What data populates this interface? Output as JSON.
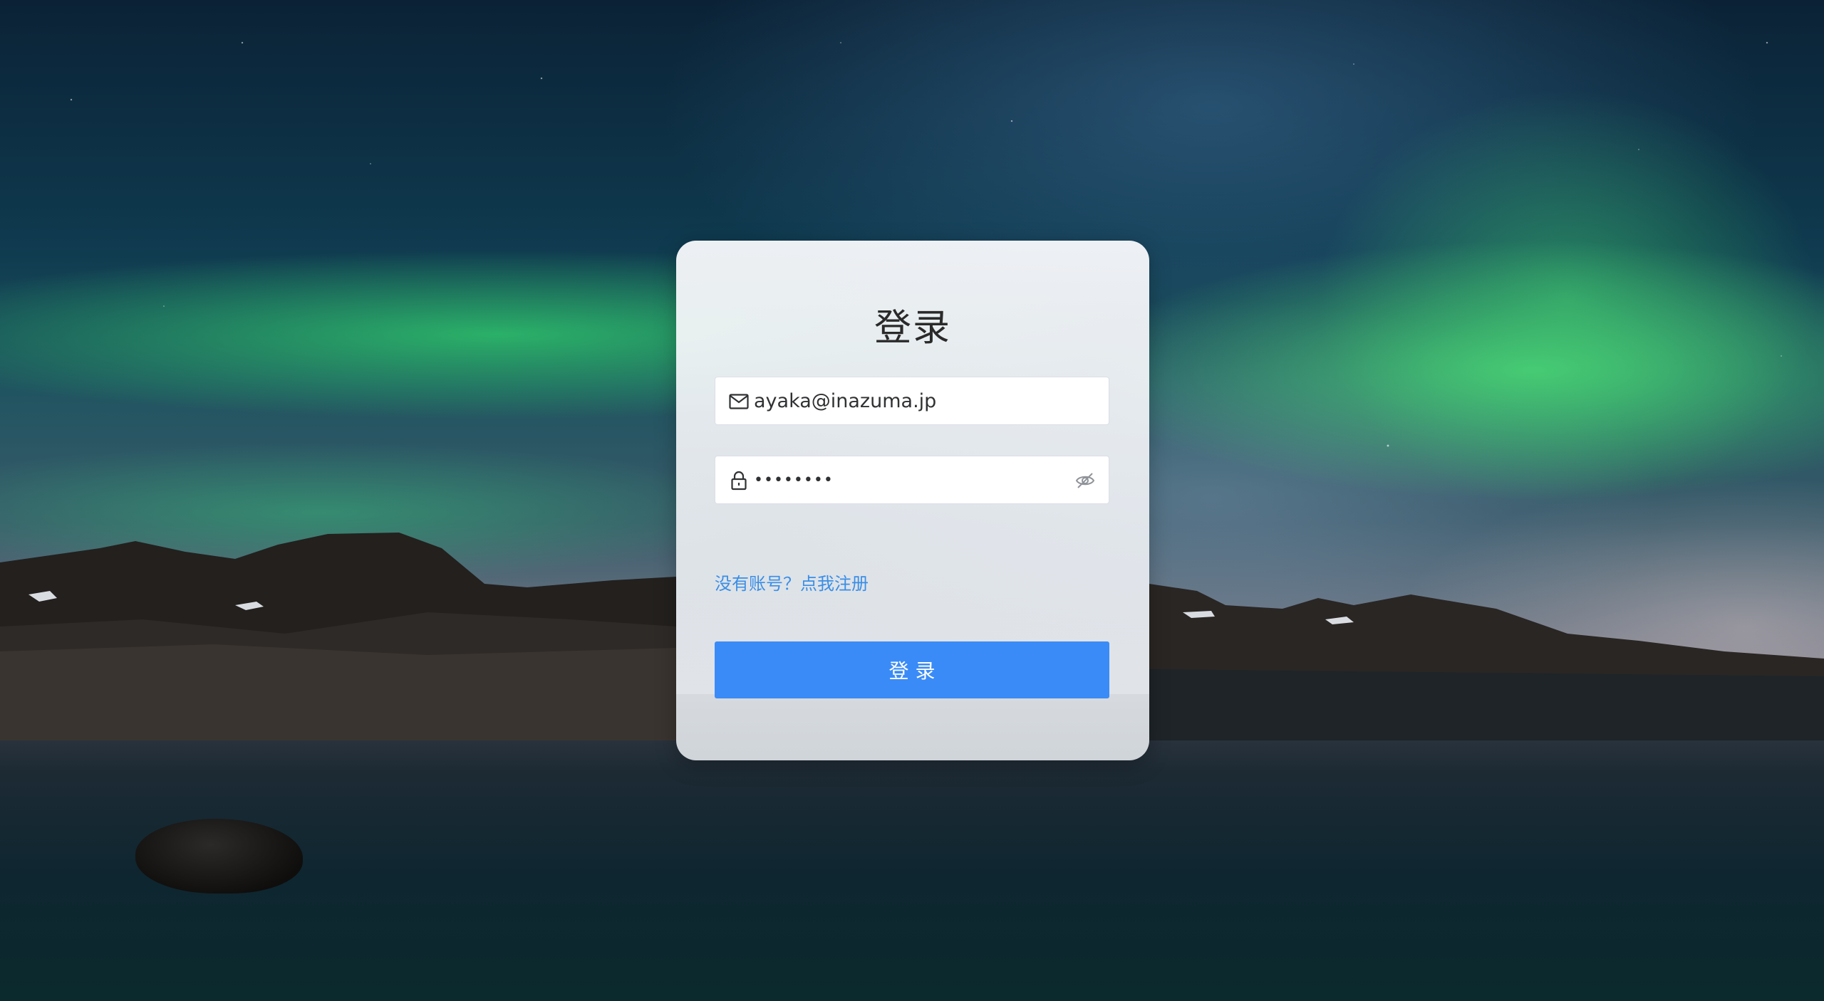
{
  "login": {
    "title": "登录",
    "email": {
      "value": "ayaka@inazuma.jp",
      "icon": "mail-icon"
    },
    "password": {
      "value": "••••••••",
      "icon": "lock-icon",
      "toggle_icon": "eye-off-icon"
    },
    "register_link": "没有账号？点我注册",
    "submit_label": "登 录"
  },
  "colors": {
    "primary": "#3a8bf7",
    "link": "#3a8ee6",
    "card_bg": "#f3f4f7"
  }
}
